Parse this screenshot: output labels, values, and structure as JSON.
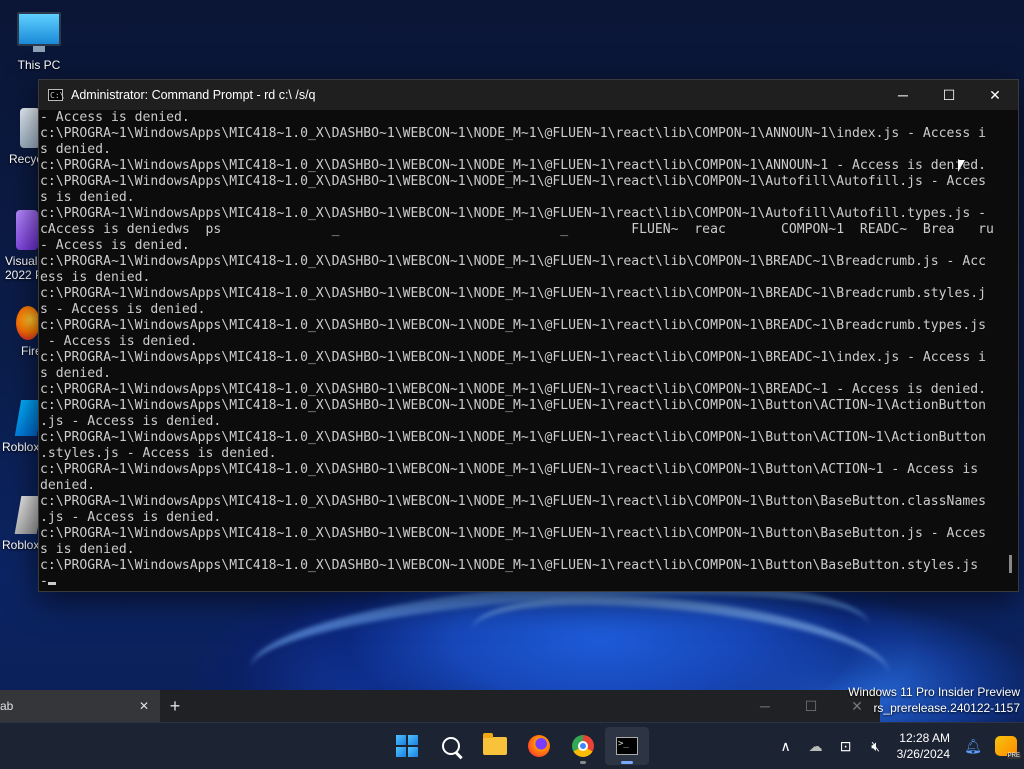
{
  "desktop": {
    "icons": [
      {
        "label": "This PC",
        "icon": "monitor-icon"
      },
      {
        "label": "Recyc",
        "icon": "recycle-bin-icon"
      },
      {
        "label": "Visual\n2022 P",
        "icon": "visual-studio-icon"
      },
      {
        "label": "Fire",
        "icon": "firefox-icon"
      },
      {
        "label": "Roblox",
        "icon": "roblox-icon"
      },
      {
        "label": "Roblox",
        "icon": "roblox-studio-icon"
      }
    ]
  },
  "window": {
    "title": "Administrator: Command Prompt - rd  c:\\ /s/q",
    "controls": {
      "minimize": "─",
      "maximize": "☐",
      "close": "✕"
    }
  },
  "console": {
    "lines": [
      "- Access is denied.",
      "c:\\PROGRA~1\\WindowsApps\\MIC418~1.0_X\\DASHBO~1\\WEBCON~1\\NODE_M~1\\@FLUEN~1\\react\\lib\\COMPON~1\\ANNOUN~1\\index.js - Access i",
      "s denied.",
      "c:\\PROGRA~1\\WindowsApps\\MIC418~1.0_X\\DASHBO~1\\WEBCON~1\\NODE_M~1\\@FLUEN~1\\react\\lib\\COMPON~1\\ANNOUN~1 - Access is denied.",
      "c:\\PROGRA~1\\WindowsApps\\MIC418~1.0_X\\DASHBO~1\\WEBCON~1\\NODE_M~1\\@FLUEN~1\\react\\lib\\COMPON~1\\Autofill\\Autofill.js - Acces",
      "s is denied.",
      "c:\\PROGRA~1\\WindowsApps\\MIC418~1.0_X\\DASHBO~1\\WEBCON~1\\NODE_M~1\\@FLUEN~1\\react\\lib\\COMPON~1\\Autofill\\Autofill.types.js -",
      "cAccess is deniedws  ps              _                            _        FLUEN~  reac       COMPON~1  READC~  Brea   ru    ase.js",
      "- Access is denied.",
      "c:\\PROGRA~1\\WindowsApps\\MIC418~1.0_X\\DASHBO~1\\WEBCON~1\\NODE_M~1\\@FLUEN~1\\react\\lib\\COMPON~1\\BREADC~1\\Breadcrumb.js - Acc",
      "ess is denied.",
      "c:\\PROGRA~1\\WindowsApps\\MIC418~1.0_X\\DASHBO~1\\WEBCON~1\\NODE_M~1\\@FLUEN~1\\react\\lib\\COMPON~1\\BREADC~1\\Breadcrumb.styles.j",
      "s - Access is denied.",
      "c:\\PROGRA~1\\WindowsApps\\MIC418~1.0_X\\DASHBO~1\\WEBCON~1\\NODE_M~1\\@FLUEN~1\\react\\lib\\COMPON~1\\BREADC~1\\Breadcrumb.types.js",
      " - Access is denied.",
      "c:\\PROGRA~1\\WindowsApps\\MIC418~1.0_X\\DASHBO~1\\WEBCON~1\\NODE_M~1\\@FLUEN~1\\react\\lib\\COMPON~1\\BREADC~1\\index.js - Access i",
      "s denied.",
      "c:\\PROGRA~1\\WindowsApps\\MIC418~1.0_X\\DASHBO~1\\WEBCON~1\\NODE_M~1\\@FLUEN~1\\react\\lib\\COMPON~1\\BREADC~1 - Access is denied.",
      "c:\\PROGRA~1\\WindowsApps\\MIC418~1.0_X\\DASHBO~1\\WEBCON~1\\NODE_M~1\\@FLUEN~1\\react\\lib\\COMPON~1\\Button\\ACTION~1\\ActionButton",
      ".js - Access is denied.",
      "c:\\PROGRA~1\\WindowsApps\\MIC418~1.0_X\\DASHBO~1\\WEBCON~1\\NODE_M~1\\@FLUEN~1\\react\\lib\\COMPON~1\\Button\\ACTION~1\\ActionButton",
      ".styles.js - Access is denied.",
      "c:\\PROGRA~1\\WindowsApps\\MIC418~1.0_X\\DASHBO~1\\WEBCON~1\\NODE_M~1\\@FLUEN~1\\react\\lib\\COMPON~1\\Button\\ACTION~1 - Access is",
      "denied.",
      "c:\\PROGRA~1\\WindowsApps\\MIC418~1.0_X\\DASHBO~1\\WEBCON~1\\NODE_M~1\\@FLUEN~1\\react\\lib\\COMPON~1\\Button\\BaseButton.classNames",
      ".js - Access is denied.",
      "c:\\PROGRA~1\\WindowsApps\\MIC418~1.0_X\\DASHBO~1\\WEBCON~1\\NODE_M~1\\@FLUEN~1\\react\\lib\\COMPON~1\\Button\\BaseButton.js - Acces",
      "s is denied.",
      "c:\\PROGRA~1\\WindowsApps\\MIC418~1.0_X\\DASHBO~1\\WEBCON~1\\NODE_M~1\\@FLUEN~1\\react\\lib\\COMPON~1\\Button\\BaseButton.styles.js",
      "-"
    ]
  },
  "browser": {
    "tab_label": "ab",
    "tab_close": "✕",
    "new_tab": "+",
    "controls": {
      "minimize": "─",
      "maximize": "☐",
      "close": "✕"
    }
  },
  "watermark": {
    "line1": "Windows 11 Pro Insider Preview",
    "line2": "rs_prerelease.240122-1157"
  },
  "taskbar": {
    "apps": [
      "start-icon",
      "search-icon",
      "file-explorer-icon",
      "firefox-icon",
      "chrome-icon",
      "command-prompt-icon"
    ],
    "tray": {
      "chevron": "∧",
      "onedrive": "☁",
      "network": "⊡",
      "volume": "🔇︎"
    },
    "time": "12:28 AM",
    "date": "3/26/2024"
  },
  "colors": {
    "console_bg": "#0c0c0c",
    "console_text": "#cccccc",
    "titlebar_bg": "#1f1f1f",
    "taskbar_bg": "#1c2333",
    "accent": "#7aa8ff"
  }
}
